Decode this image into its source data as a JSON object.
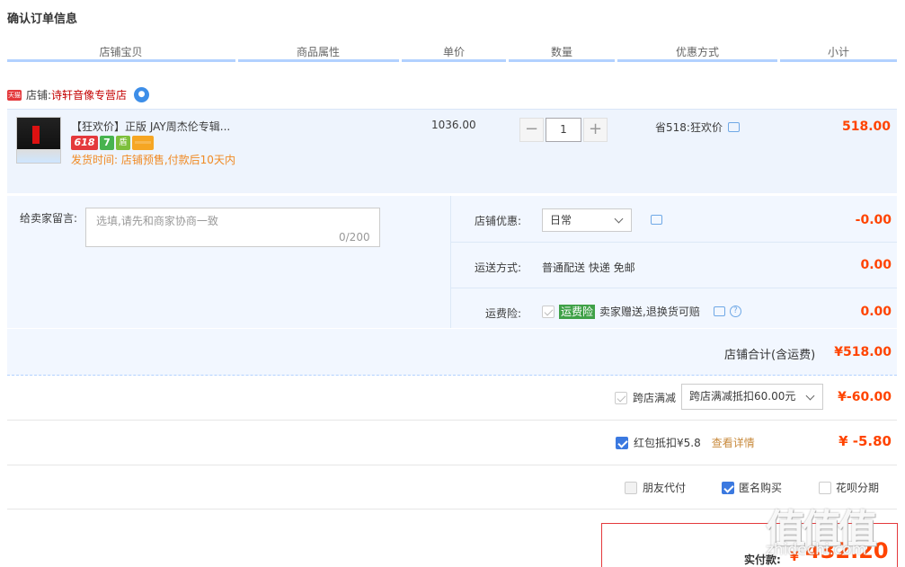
{
  "page_title": "确认订单信息",
  "columns": [
    "店铺宝贝",
    "商品属性",
    "单价",
    "数量",
    "优惠方式",
    "小计"
  ],
  "shop": {
    "badge": "天猫",
    "label": "店铺:",
    "name": "诗轩音像专营店",
    "chat_icon": "wangwang-chat-icon"
  },
  "item": {
    "title": "【狂欢价】正版 JAY周杰伦专辑...",
    "badges": {
      "b618": "618",
      "b7": "7",
      "guard": "盾"
    },
    "ship_time": "发货时间: 店铺预售,付款后10天内",
    "unit_price": "1036.00",
    "quantity": "1",
    "minus": "−",
    "plus": "+",
    "promo": "省518:狂欢价",
    "subtotal": "518.00"
  },
  "message": {
    "label": "给卖家留言:",
    "placeholder": "选填,请先和商家协商一致",
    "count": "0/200"
  },
  "shop_discount": {
    "label": "店铺优惠:",
    "value": "日常",
    "amount": "-0.00"
  },
  "shipping": {
    "label": "运送方式:",
    "value": "普通配送 快递 免邮",
    "amount": "0.00"
  },
  "insurance": {
    "label": "运费险:",
    "badge": "运费险",
    "text": "卖家赠送,退换货可赔",
    "help": "?",
    "amount": "0.00"
  },
  "shop_total": {
    "label": "店铺合计(含运费)",
    "amount": "¥518.00"
  },
  "cross_store": {
    "label": "跨店满减",
    "select": "跨店满减抵扣60.00元",
    "amount": "¥-60.00",
    "checked": true
  },
  "red_packet": {
    "label": "红包抵扣¥5.8",
    "link": "查看详情",
    "amount": "¥ -5.80",
    "checked": true
  },
  "options": {
    "friend_pay": "朋友代付",
    "anonymous": "匿名购买",
    "huabei": "花呗分期"
  },
  "pay": {
    "label": "实付款:",
    "currency": "¥",
    "amount": "432.20"
  },
  "watermark": {
    "main": "值值值",
    "sub": "zhidechi.com"
  },
  "colors": {
    "accent": "#f40",
    "header_line": "#b2d1ff",
    "item_bg": "#eef4fd",
    "checkbox": "#3b79e0"
  }
}
